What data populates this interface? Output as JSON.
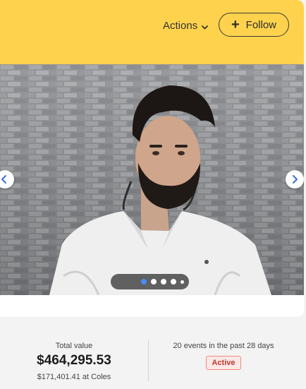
{
  "header": {
    "actions_label": "Actions",
    "follow_label": "Follow",
    "accent_color": "#fed24c"
  },
  "carousel": {
    "image_description": "person in white polo shirt on brick pavement",
    "slide_count": 5,
    "active_index": 0
  },
  "summary": {
    "total_label": "Total value",
    "total_value": "$464,295.53",
    "sub_value": "$171,401.41 at Coles",
    "events_text": "20 events in the past 28 days",
    "status_badge": "Active"
  }
}
